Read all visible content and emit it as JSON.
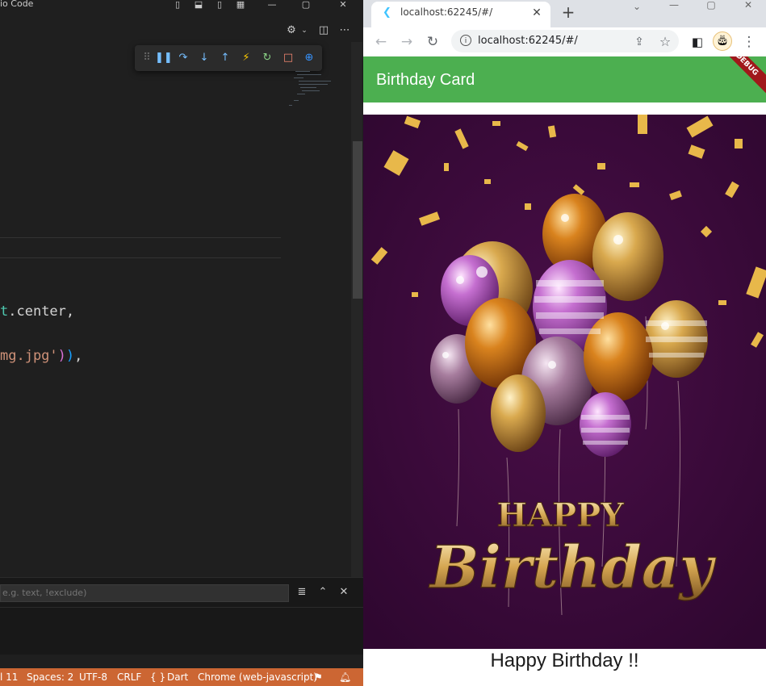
{
  "vscode": {
    "title_fragment": "io Code",
    "code_lines": [
      {
        "frag_teal": "t",
        "frag_plain": ".center,"
      },
      {
        "frag_str": "mg.jpg'",
        "frag_close1": ")",
        "frag_close2": ")",
        "frag_tail": ","
      }
    ],
    "panel": {
      "filter_placeholder": "e.g. text, !exclude)"
    },
    "statusbar": {
      "line": "l 11",
      "spaces": "Spaces: 2",
      "encoding": "UTF-8",
      "eol": "CRLF",
      "language_braces": "{ }",
      "language": "Dart",
      "device": "Chrome (web-javascript)"
    },
    "debug_toolbar": [
      "drag-handle",
      "pause",
      "step-over",
      "step-into",
      "step-out",
      "hot-reload",
      "hot-restart",
      "stop",
      "devtools"
    ]
  },
  "chrome": {
    "tab_title": "localhost:62245/#/",
    "url": "localhost:62245/#/"
  },
  "app": {
    "title": "Birthday Card",
    "debug_label": "DEBUG",
    "image_text_happy": "HAPPY",
    "image_text_birthday": "Birthday",
    "caption": "Happy Birthday !!",
    "colors": {
      "appbar": "#4caf50",
      "background": "#3a0a38",
      "gold": "#e0b64a"
    }
  }
}
